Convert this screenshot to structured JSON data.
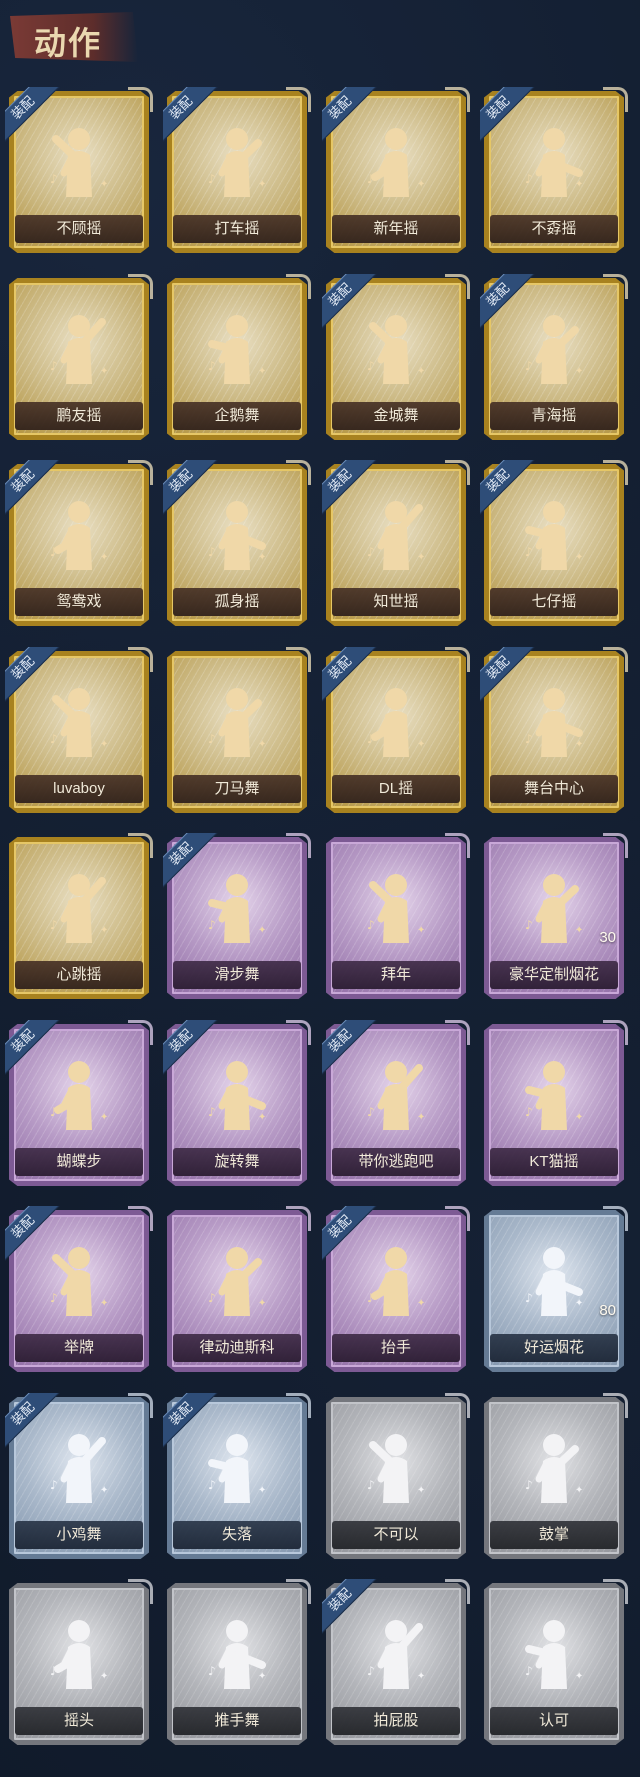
{
  "header": {
    "title": "动作"
  },
  "equip_badge_text": "装配",
  "tiers": {
    "gold": "#b09039",
    "purple": "#8e6aa3",
    "blue": "#7f93ab",
    "grey": "#8f9197"
  },
  "items": [
    {
      "label": "不顾摇",
      "tier": "gold",
      "equipped": true
    },
    {
      "label": "打车摇",
      "tier": "gold",
      "equipped": true
    },
    {
      "label": "新年摇",
      "tier": "gold",
      "equipped": true
    },
    {
      "label": "不孬摇",
      "tier": "gold",
      "equipped": true
    },
    {
      "label": "鹏友摇",
      "tier": "gold",
      "equipped": false
    },
    {
      "label": "企鹅舞",
      "tier": "gold",
      "equipped": false
    },
    {
      "label": "金城舞",
      "tier": "gold",
      "equipped": true
    },
    {
      "label": "青海摇",
      "tier": "gold",
      "equipped": true
    },
    {
      "label": "鸳鸯戏",
      "tier": "gold",
      "equipped": true
    },
    {
      "label": "孤身摇",
      "tier": "gold",
      "equipped": true
    },
    {
      "label": "知世摇",
      "tier": "gold",
      "equipped": true
    },
    {
      "label": "七仔摇",
      "tier": "gold",
      "equipped": true
    },
    {
      "label": "luvaboy",
      "tier": "gold",
      "equipped": true
    },
    {
      "label": "刀马舞",
      "tier": "gold",
      "equipped": false
    },
    {
      "label": "DL摇",
      "tier": "gold",
      "equipped": true
    },
    {
      "label": "舞台中心",
      "tier": "gold",
      "equipped": true
    },
    {
      "label": "心跳摇",
      "tier": "gold",
      "equipped": false
    },
    {
      "label": "滑步舞",
      "tier": "purple",
      "equipped": true
    },
    {
      "label": "拜年",
      "tier": "purple",
      "equipped": false
    },
    {
      "label": "豪华定制烟花",
      "tier": "purple",
      "equipped": false,
      "count": "30"
    },
    {
      "label": "蝴蝶步",
      "tier": "purple",
      "equipped": true
    },
    {
      "label": "旋转舞",
      "tier": "purple",
      "equipped": true
    },
    {
      "label": "带你逃跑吧",
      "tier": "purple",
      "equipped": true
    },
    {
      "label": "KT猫摇",
      "tier": "purple",
      "equipped": false
    },
    {
      "label": "举牌",
      "tier": "purple",
      "equipped": true
    },
    {
      "label": "律动迪斯科",
      "tier": "purple",
      "equipped": false
    },
    {
      "label": "抬手",
      "tier": "purple",
      "equipped": true
    },
    {
      "label": "好运烟花",
      "tier": "blue",
      "equipped": false,
      "count": "80"
    },
    {
      "label": "小鸡舞",
      "tier": "blue",
      "equipped": true
    },
    {
      "label": "失落",
      "tier": "blue",
      "equipped": true
    },
    {
      "label": "不可以",
      "tier": "grey",
      "equipped": false
    },
    {
      "label": "鼓掌",
      "tier": "grey",
      "equipped": false
    },
    {
      "label": "摇头",
      "tier": "grey",
      "equipped": false
    },
    {
      "label": "推手舞",
      "tier": "grey",
      "equipped": false
    },
    {
      "label": "拍屁股",
      "tier": "grey",
      "equipped": true
    },
    {
      "label": "认可",
      "tier": "grey",
      "equipped": false
    }
  ]
}
